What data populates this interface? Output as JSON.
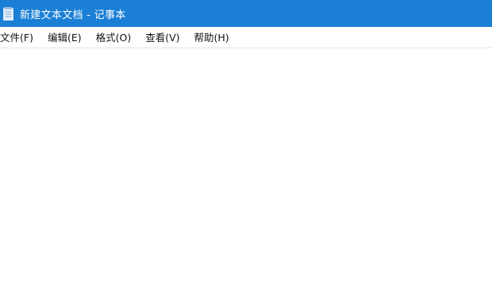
{
  "window": {
    "title": "新建文本文档 - 记事本",
    "icon": "notepad-icon",
    "accent_color": "#1b7fd6"
  },
  "menubar": {
    "items": [
      {
        "label": "文件(F)"
      },
      {
        "label": "编辑(E)"
      },
      {
        "label": "格式(O)"
      },
      {
        "label": "查看(V)"
      },
      {
        "label": "帮助(H)"
      }
    ]
  },
  "editor": {
    "content": ""
  }
}
